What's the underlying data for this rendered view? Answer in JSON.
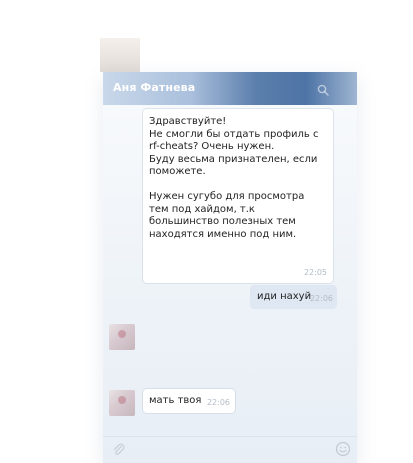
{
  "header": {
    "title": "Аня Фатнева"
  },
  "messages": [
    {
      "direction": "in",
      "text": "Здравствуйте!\nНе смогли бы отдать профиль с rf-cheats? Очень нужен.\nБуду весьма признателен, если поможете.\n\nНужен сугубо для просмотра тем под хайдом, т.к большинство полезных тем находятся именно под ним.",
      "time": "22:05"
    },
    {
      "direction": "out",
      "text": "иди нахуй",
      "time": "22:06"
    },
    {
      "direction": "in",
      "text": "мать твоя",
      "time": "22:06"
    }
  ],
  "icons": {
    "search": "search-icon",
    "attach": "paperclip-icon",
    "emoji": "smile-icon"
  },
  "colors": {
    "header_accent": "#4d74a6",
    "outgoing_bubble": "#dfe8f2",
    "incoming_bubble": "#ffffff"
  }
}
